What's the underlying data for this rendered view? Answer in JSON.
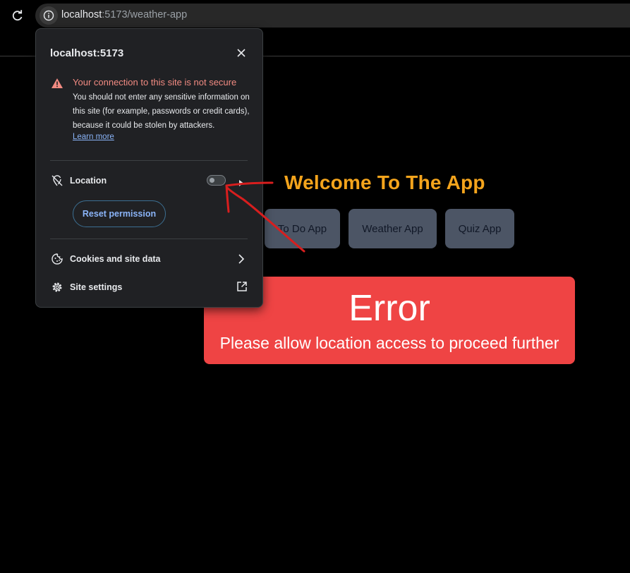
{
  "browser": {
    "url_host": "localhost",
    "url_path": ":5173/weather-app"
  },
  "page": {
    "welcome": "Welcome To The App",
    "nav_buttons": [
      "To Do App",
      "Weather App",
      "Quiz App"
    ],
    "error_title": "Error",
    "error_message": "Please allow location access to proceed further"
  },
  "popup": {
    "title": "localhost:5173",
    "warning_title": "Your connection to this site is not secure",
    "warning_body": "You should not enter any sensitive information on this site (for example, passwords or credit cards), because it could be stolen by attackers.",
    "learn_more": "Learn more",
    "location_label": "Location",
    "location_enabled": false,
    "reset_label": "Reset permission",
    "cookies_label": "Cookies and site data",
    "site_settings_label": "Site settings"
  },
  "icons": {
    "reload": "reload-icon",
    "info": "info-icon",
    "close": "close-icon",
    "warning": "warning-icon",
    "location_off": "location-off-icon",
    "cookie": "cookie-icon",
    "gear": "gear-icon",
    "external": "open-external-icon"
  },
  "colors": {
    "welcome": "#f4a41c",
    "error_bg": "#ef4444",
    "warning_text": "#f28b82",
    "link": "#8ab4f8",
    "annotation": "#d81e1e"
  }
}
